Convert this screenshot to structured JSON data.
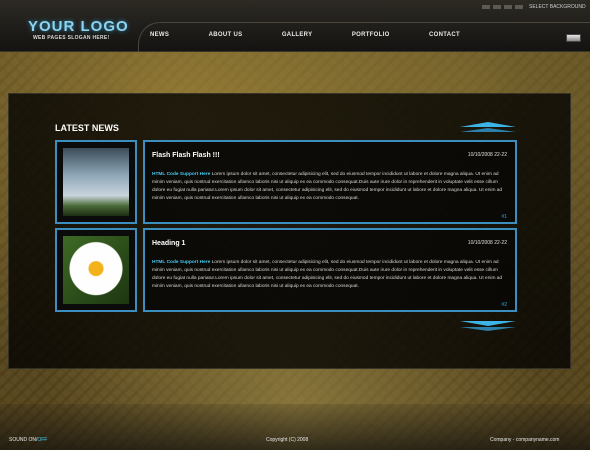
{
  "header": {
    "logo": "YOUR LOGO",
    "slogan": "WEB PAGES SLOGAN HERE!",
    "select_background": "SELECT BACKGROUND",
    "nav": [
      "NEWS",
      "ABOUT US",
      "GALLERY",
      "PORTFOLIO",
      "CONTACT"
    ]
  },
  "main": {
    "section_title": "LATEST NEWS",
    "items": [
      {
        "title": "Flash Flash Flash !!!",
        "date": "10/10/2008 22-22",
        "support": "HTML Code Support Here",
        "body": "Lorem ipsum dolor sit amet, consectetur adipisicing elit, sed do eiusmod tempor incididunt ut labore et dolore magna aliqua. Ut enim ad minim veniam, quis nostrud exercitation ullamco laboris nisi ut aliquip ex ea commodo consequat.Duis aute irure dolor in reprehenderit in voluptate velit esse cillum dolore eu fugiat nulla pariatur.Lorem ipsum dolor sit amet, consectetur adipisicing elit, sed do eiusmod tempor incididunt ut labore et dolore magna aliqua. Ut enim ad minim veniam, quis nostrud exercitation ullamco laboris nisi ut aliquip ex ea commodo consequat.",
        "num": "#1"
      },
      {
        "title": "Heading 1",
        "date": "10/10/2008 22-22",
        "support": "HTML Code Support Here",
        "body": "Lorem ipsum dolor sit amet, consectetur adipisicing elit, sed do eiusmod tempor incididunt ut labore et dolore magna aliqua. Ut enim ad minim veniam, quis nostrud exercitation ullamco laboris nisi ut aliquip ex ea commodo consequat.Duis aute irure dolor in reprehenderit in voluptate velit esse cillum dolore eu fugiat nulla pariatur.Lorem ipsum dolor sit amet, consectetur adipisicing elit, sed do eiusmod tempor incididunt ut labore et dolore magna aliqua. Ut enim ad minim veniam, quis nostrud exercitation ullamco laboris nisi ut aliquip ex ea commodo consequat.",
        "num": "#2"
      }
    ]
  },
  "footer": {
    "sound_on": "SOUND ON/",
    "sound_off": "OFF",
    "copyright": "Copyright (C) 2008",
    "company": "Company - companyname.com"
  },
  "colors": {
    "accent": "#3cb4e6",
    "border": "#3b8ebf"
  }
}
